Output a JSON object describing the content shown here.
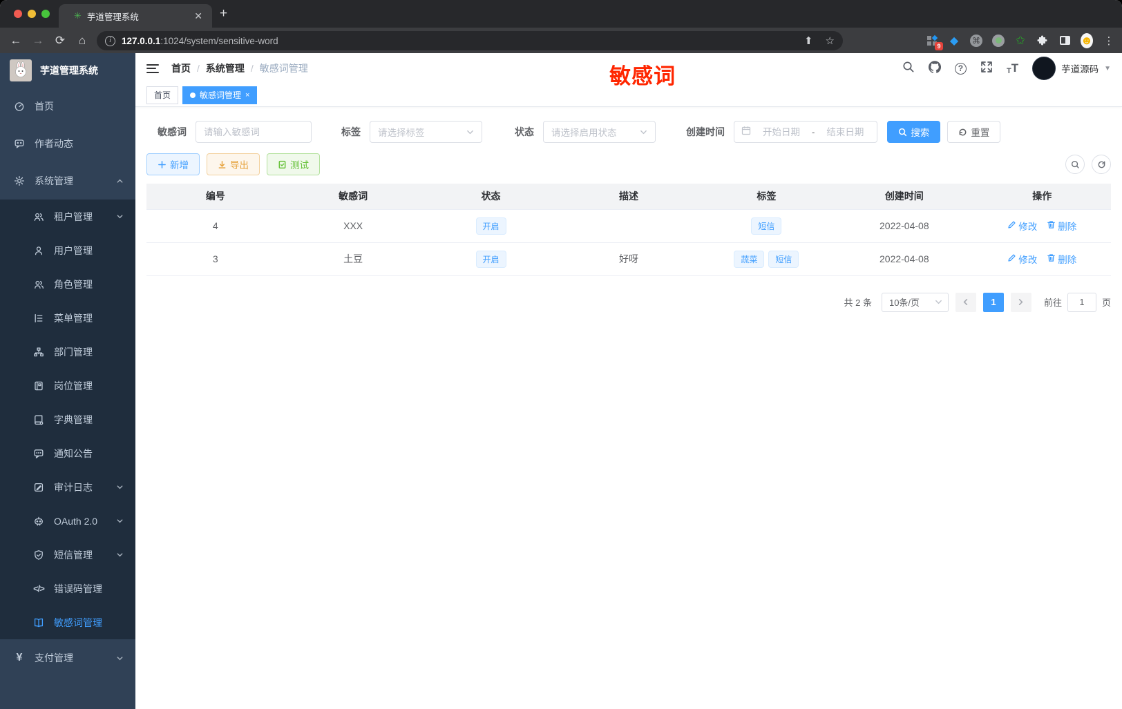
{
  "colors": {
    "accent": "#409eff",
    "sidebar_bg": "#304156",
    "submenu_bg": "#1f2d3d",
    "annotation_red": "#ff2600",
    "warning": "#e6a23c",
    "success": "#67c23a"
  },
  "browser": {
    "tab_title": "芋道管理系统",
    "url_host": "127.0.0.1",
    "url_path": ":1024/system/sensitive-word",
    "extension_badge": "9",
    "new_tab_glyph": "+"
  },
  "sidebar": {
    "logo_title": "芋道管理系统",
    "items": [
      {
        "label": "首页",
        "icon": "dashboard-icon",
        "level": "top",
        "arrow": ""
      },
      {
        "label": "作者动态",
        "icon": "author-feed-icon",
        "level": "top",
        "arrow": ""
      },
      {
        "label": "系统管理",
        "icon": "gear-icon",
        "level": "top",
        "arrow": "up"
      },
      {
        "label": "租户管理",
        "icon": "tenant-users-icon",
        "level": "sub",
        "arrow": "down"
      },
      {
        "label": "用户管理",
        "icon": "user-icon",
        "level": "sub",
        "arrow": ""
      },
      {
        "label": "角色管理",
        "icon": "role-users-icon",
        "level": "sub",
        "arrow": ""
      },
      {
        "label": "菜单管理",
        "icon": "menu-tree-icon",
        "level": "sub",
        "arrow": ""
      },
      {
        "label": "部门管理",
        "icon": "org-tree-icon",
        "level": "sub",
        "arrow": ""
      },
      {
        "label": "岗位管理",
        "icon": "post-badge-icon",
        "level": "sub",
        "arrow": ""
      },
      {
        "label": "字典管理",
        "icon": "dictionary-book-icon",
        "level": "sub",
        "arrow": ""
      },
      {
        "label": "通知公告",
        "icon": "announcement-icon",
        "level": "sub",
        "arrow": ""
      },
      {
        "label": "审计日志",
        "icon": "audit-log-icon",
        "level": "sub",
        "arrow": "down"
      },
      {
        "label": "OAuth 2.0",
        "icon": "oauth-robot-icon",
        "level": "sub",
        "arrow": "down"
      },
      {
        "label": "短信管理",
        "icon": "sms-shield-icon",
        "level": "sub",
        "arrow": "down"
      },
      {
        "label": "错误码管理",
        "icon": "error-code-icon",
        "level": "sub",
        "arrow": ""
      },
      {
        "label": "敏感词管理",
        "icon": "sensitive-word-book-icon",
        "level": "sub",
        "arrow": "",
        "active": true
      },
      {
        "label": "支付管理",
        "icon": "payment-yen-icon",
        "level": "top",
        "arrow": "down"
      }
    ]
  },
  "header": {
    "breadcrumb": [
      "首页",
      "系统管理",
      "敏感词管理"
    ],
    "annotation": "敏感词",
    "user_name": "芋道源码"
  },
  "tags": {
    "items": [
      {
        "label": "首页",
        "active": false
      },
      {
        "label": "敏感词管理",
        "active": true,
        "closable": true
      }
    ]
  },
  "filters": {
    "keyword_label": "敏感词",
    "keyword_placeholder": "请输入敏感词",
    "tag_label": "标签",
    "tag_placeholder": "请选择标签",
    "status_label": "状态",
    "status_placeholder": "请选择启用状态",
    "date_label": "创建时间",
    "date_start_placeholder": "开始日期",
    "date_separator": "-",
    "date_end_placeholder": "结束日期",
    "search_label": "搜索",
    "reset_label": "重置"
  },
  "toolbar": {
    "add_label": "新增",
    "export_label": "导出",
    "test_label": "测试"
  },
  "table": {
    "columns": [
      "编号",
      "敏感词",
      "状态",
      "描述",
      "标签",
      "创建时间",
      "操作"
    ],
    "rows": [
      {
        "id": "4",
        "word": "XXX",
        "status": "开启",
        "description": "",
        "tags": [
          "短信"
        ],
        "created": "2022-04-08"
      },
      {
        "id": "3",
        "word": "土豆",
        "status": "开启",
        "description": "好呀",
        "tags": [
          "蔬菜",
          "短信"
        ],
        "created": "2022-04-08"
      }
    ],
    "edit_label": "修改",
    "delete_label": "删除"
  },
  "pagination": {
    "total_text": "共 2 条",
    "page_size_text": "10条/页",
    "current_page": "1",
    "goto_label": "前往",
    "goto_value": "1",
    "page_suffix": "页"
  }
}
